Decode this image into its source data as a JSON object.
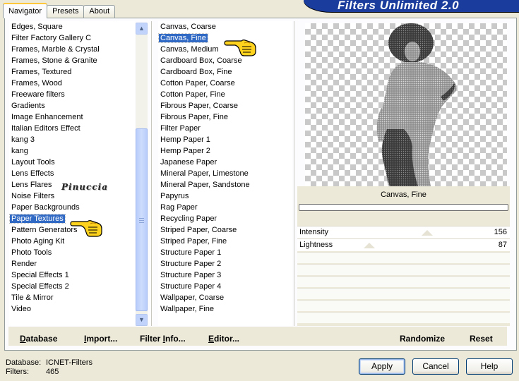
{
  "window": {
    "banner_title": "Filters Unlimited 2.0"
  },
  "tabs": [
    {
      "label": "Navigator",
      "active": true
    },
    {
      "label": "Presets",
      "active": false
    },
    {
      "label": "About",
      "active": false
    }
  ],
  "categories": {
    "items": [
      "Edges, Square",
      "Filter Factory Gallery C",
      "Frames, Marble & Crystal",
      "Frames, Stone & Granite",
      "Frames, Textured",
      "Frames, Wood",
      "Freeware filters",
      "Gradients",
      "Image Enhancement",
      "Italian Editors Effect",
      "kang 3",
      "kang",
      "Layout Tools",
      "Lens Effects",
      "Lens Flares",
      "Noise Filters",
      "Paper Backgrounds",
      "Paper Textures",
      "Pattern Generators",
      "Photo Aging Kit",
      "Photo Tools",
      "Render",
      "Special Effects 1",
      "Special Effects 2",
      "Tile & Mirror",
      "Video"
    ],
    "selected": "Paper Textures"
  },
  "filters": {
    "items": [
      "Canvas, Coarse",
      "Canvas, Fine",
      "Canvas, Medium",
      "Cardboard Box, Coarse",
      "Cardboard Box, Fine",
      "Cotton Paper, Coarse",
      "Cotton Paper, Fine",
      "Fibrous Paper, Coarse",
      "Fibrous Paper, Fine",
      "Filter Paper",
      "Hemp Paper 1",
      "Hemp Paper 2",
      "Japanese Paper",
      "Mineral Paper, Limestone",
      "Mineral Paper, Sandstone",
      "Papyrus",
      "Rag Paper",
      "Recycling Paper",
      "Striped Paper, Coarse",
      "Striped Paper, Fine",
      "Structure Paper 1",
      "Structure Paper 2",
      "Structure Paper 3",
      "Structure Paper 4",
      "Wallpaper, Coarse",
      "Wallpaper, Fine"
    ],
    "selected": "Canvas, Fine"
  },
  "preview": {
    "filter_name": "Canvas, Fine",
    "progress": 0
  },
  "parameters": [
    {
      "label": "Intensity",
      "value": "156",
      "level": 0.61
    },
    {
      "label": "Lightness",
      "value": "87",
      "level": 0.34
    }
  ],
  "toolbar": {
    "database": "Database",
    "import": "Import...",
    "filter_info": "Filter Info...",
    "editor": "Editor...",
    "randomize": "Randomize",
    "reset": "Reset"
  },
  "footer": {
    "database_label": "Database:",
    "database_value": "ICNET-Filters",
    "filters_label": "Filters:",
    "filters_value": "465"
  },
  "buttons": {
    "apply": "Apply",
    "cancel": "Cancel",
    "help": "Help"
  },
  "watermark": "Pinuccia",
  "colors": {
    "selection": "#316ac5",
    "banner": "#1a3c9c",
    "active_tab_accent": "#ffc83c"
  }
}
